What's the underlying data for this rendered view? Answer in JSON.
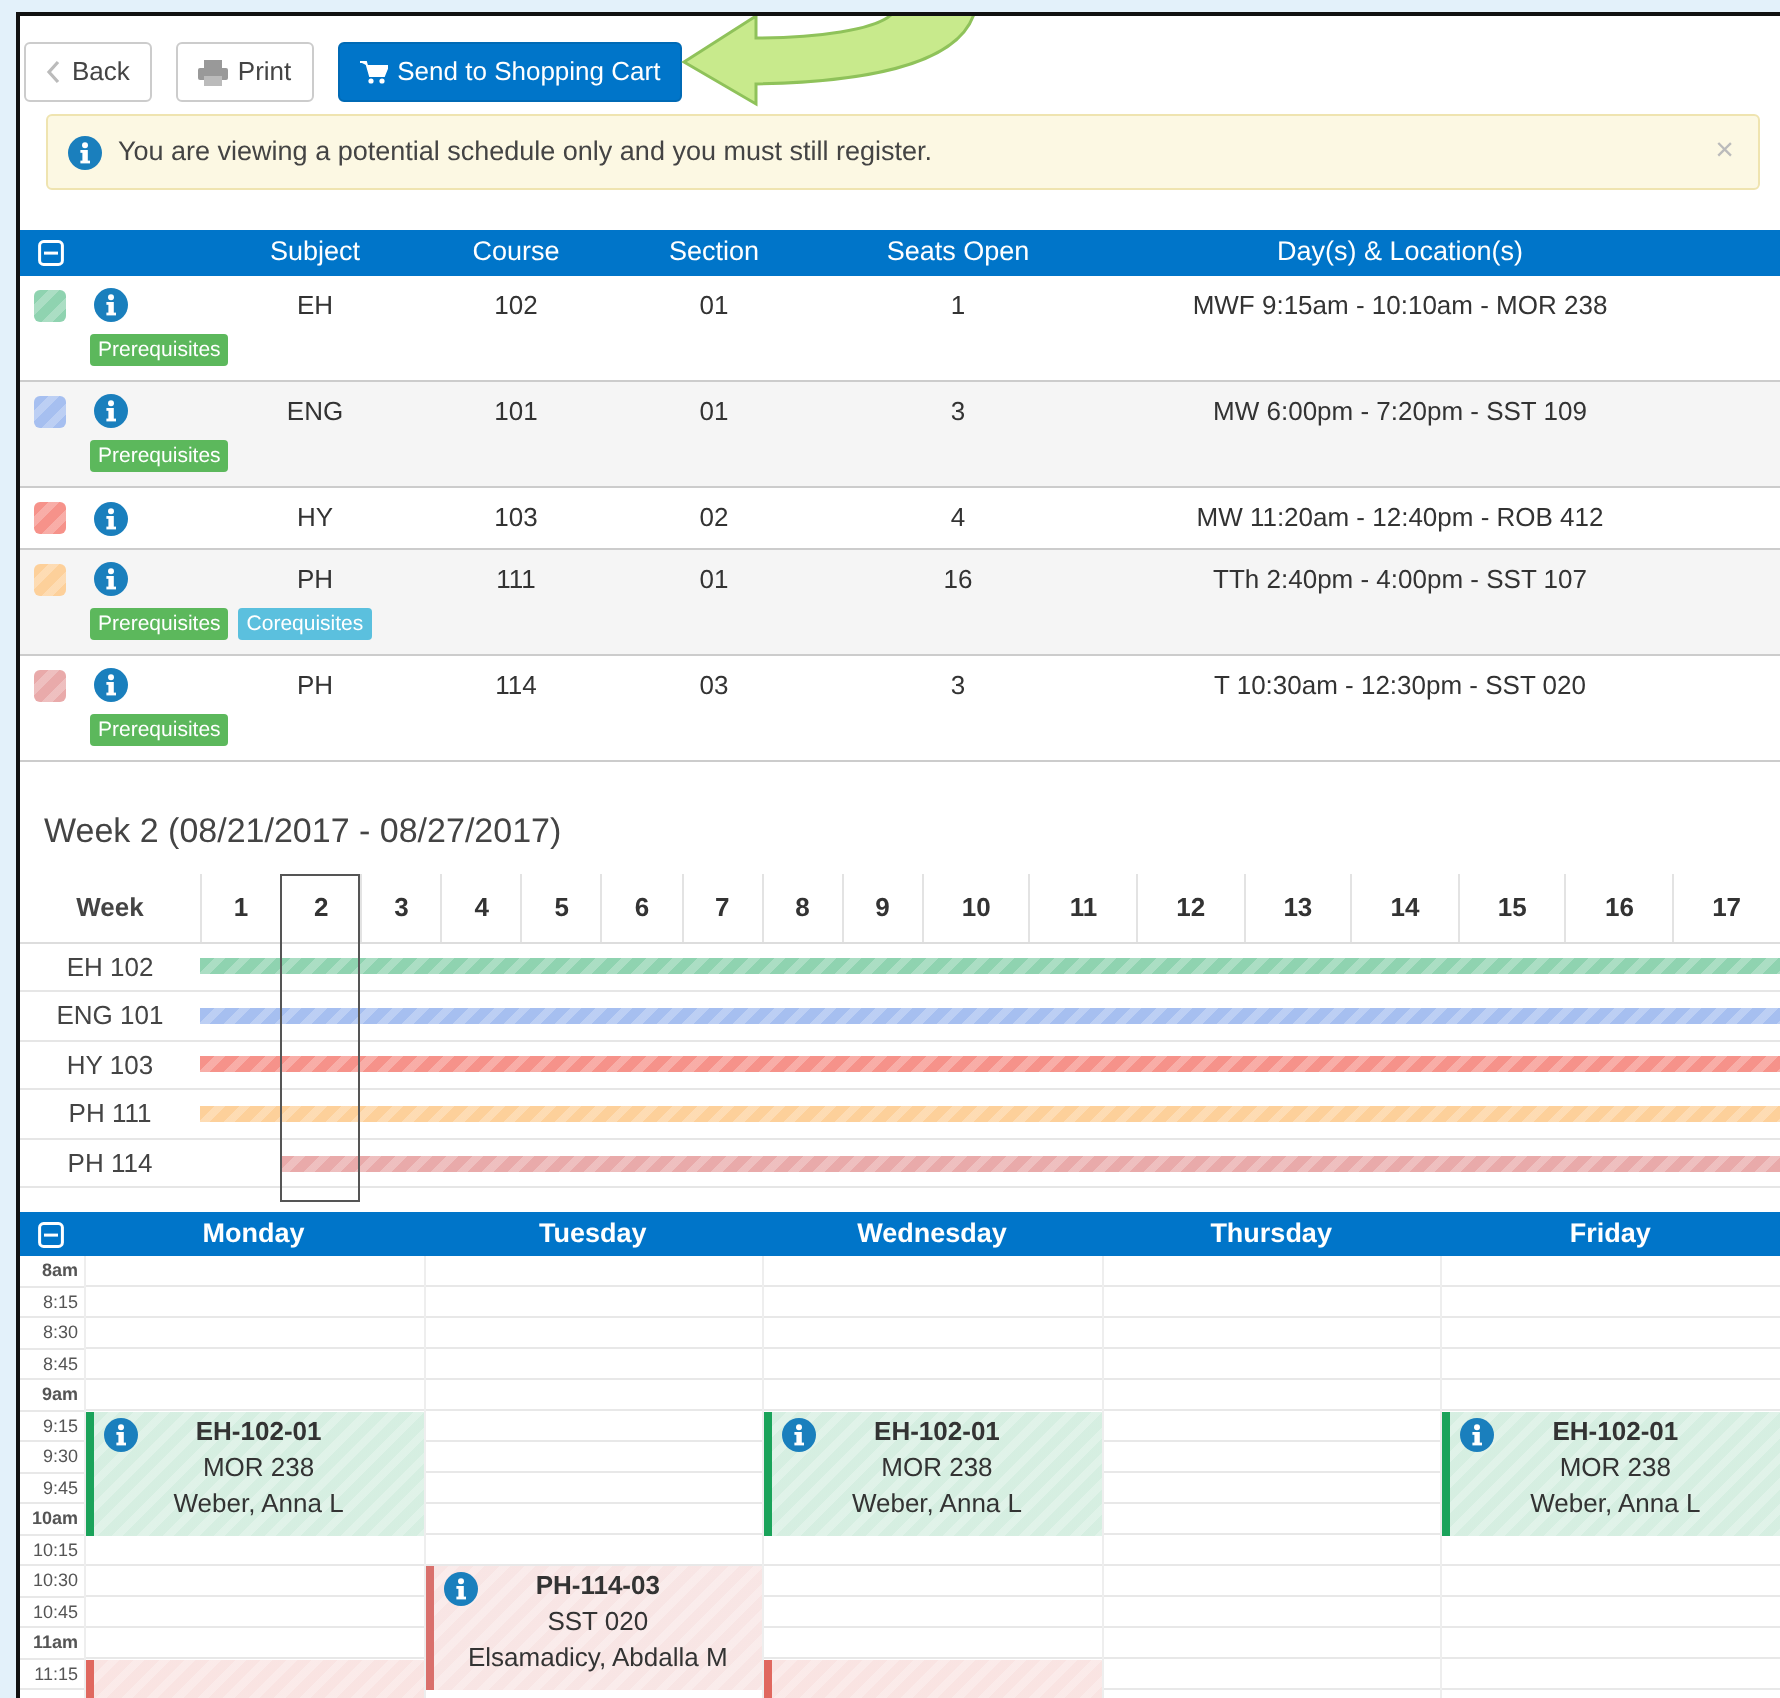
{
  "toolbar": {
    "buttons": [
      {
        "label": "Back",
        "kind": "back"
      },
      {
        "label": "Print",
        "kind": "print"
      },
      {
        "label": "Send to Shopping Cart",
        "kind": "cart"
      }
    ]
  },
  "alert": {
    "message": "You are viewing a potential schedule only and you must still register.",
    "close": "×"
  },
  "courses": {
    "columns": [
      "Subject",
      "Course",
      "Section",
      "Seats Open",
      "Day(s) & Location(s)"
    ],
    "rows": [
      {
        "color": "#8fd3b0",
        "subject": "EH",
        "course": "102",
        "section": "01",
        "seats": "1",
        "days": "MWF 9:15am - 10:10am - MOR 238",
        "badges": [
          {
            "label": "Prerequisites",
            "kind": "prerequisite"
          }
        ]
      },
      {
        "color": "#a6bff0",
        "subject": "ENG",
        "course": "101",
        "section": "01",
        "seats": "3",
        "days": "MW 6:00pm - 7:20pm - SST 109",
        "badges": [
          {
            "label": "Prerequisites",
            "kind": "prerequisite"
          }
        ]
      },
      {
        "color": "#f6928a",
        "subject": "HY",
        "course": "103",
        "section": "02",
        "seats": "4",
        "days": "MW 11:20am - 12:40pm - ROB 412"
      },
      {
        "color": "#fdd09a",
        "subject": "PH",
        "course": "111",
        "section": "01",
        "seats": "16",
        "days": "TTh 2:40pm - 4:00pm - SST 107",
        "badges": [
          {
            "label": "Prerequisites",
            "kind": "prerequisite"
          },
          {
            "label": "Corequisites",
            "kind": "corequisite"
          }
        ]
      },
      {
        "color": "#e9aaaa",
        "subject": "PH",
        "course": "114",
        "section": "03",
        "seats": "3",
        "days": "T 10:30am - 12:30pm - SST 020",
        "badges": [
          {
            "label": "Prerequisites",
            "kind": "prerequisite"
          }
        ]
      }
    ]
  },
  "week_title": "Week 2 (08/21/2017 - 08/27/2017)",
  "weeks": {
    "heading": "Week",
    "columns": [
      {
        "label": "1",
        "selected": false
      },
      {
        "label": "2",
        "selected": true
      },
      {
        "label": "3",
        "selected": false
      },
      {
        "label": "4",
        "selected": false
      },
      {
        "label": "5",
        "selected": false
      },
      {
        "label": "6",
        "selected": false
      },
      {
        "label": "7",
        "selected": false
      },
      {
        "label": "8",
        "selected": false
      },
      {
        "label": "9",
        "selected": false
      },
      {
        "label": "10",
        "selected": false
      },
      {
        "label": "11",
        "selected": false
      },
      {
        "label": "12",
        "selected": false
      },
      {
        "label": "13",
        "selected": false
      },
      {
        "label": "14",
        "selected": false
      },
      {
        "label": "15",
        "selected": false
      },
      {
        "label": "16",
        "selected": false
      },
      {
        "label": "17",
        "selected": false
      }
    ],
    "rows": [
      {
        "label": "EH 102",
        "color": "#8fd3b0",
        "in_week_1": true
      },
      {
        "label": "ENG 101",
        "color": "#a6bff0",
        "in_week_1": true
      },
      {
        "label": "HY 103",
        "color": "#f6928a",
        "in_week_1": true
      },
      {
        "label": "PH 111",
        "color": "#fdd09a",
        "in_week_1": true
      },
      {
        "label": "PH 114",
        "color": "#e9aaaa",
        "in_week_1": false
      }
    ]
  },
  "calendar": {
    "days": [
      {
        "label": "Monday",
        "blocks": [
          {
            "kind": "free"
          },
          {
            "kind": "free"
          },
          {
            "kind": "free"
          },
          {
            "kind": "free"
          },
          {
            "kind": "free"
          },
          {
            "kind": "class",
            "color": "#1aa35a",
            "code": "EH-102-01",
            "room": "MOR 238",
            "teacher": "Weber, Anna L"
          },
          {
            "kind": "free"
          },
          {
            "kind": "free"
          },
          {
            "kind": "free"
          },
          {
            "kind": "free"
          },
          {
            "kind": "class",
            "color": "#e0685f"
          }
        ]
      },
      {
        "label": "Tuesday",
        "blocks": [
          {
            "kind": "free"
          },
          {
            "kind": "free"
          },
          {
            "kind": "free"
          },
          {
            "kind": "free"
          },
          {
            "kind": "free"
          },
          {
            "kind": "free"
          },
          {
            "kind": "free"
          },
          {
            "kind": "free"
          },
          {
            "kind": "free"
          },
          {
            "kind": "free"
          },
          {
            "kind": "class",
            "color": "#d9706c",
            "code": "PH-114-03",
            "room": "SST 020",
            "teacher": "Elsamadicy, Abdalla M"
          }
        ]
      },
      {
        "label": "Wednesday",
        "blocks": [
          {
            "kind": "free"
          },
          {
            "kind": "free"
          },
          {
            "kind": "free"
          },
          {
            "kind": "free"
          },
          {
            "kind": "free"
          },
          {
            "kind": "class",
            "color": "#1aa35a",
            "code": "EH-102-01",
            "room": "MOR 238",
            "teacher": "Weber, Anna L"
          },
          {
            "kind": "free"
          },
          {
            "kind": "free"
          },
          {
            "kind": "free"
          },
          {
            "kind": "free"
          },
          {
            "kind": "class",
            "color": "#e0685f"
          }
        ]
      },
      {
        "label": "Thursday"
      },
      {
        "label": "Friday",
        "blocks": [
          {
            "kind": "free"
          },
          {
            "kind": "free"
          },
          {
            "kind": "free"
          },
          {
            "kind": "free"
          },
          {
            "kind": "free"
          },
          {
            "kind": "class",
            "color": "#1aa35a",
            "code": "EH-102-01",
            "room": "MOR 238",
            "teacher": "Weber, Anna L"
          }
        ]
      }
    ],
    "times": [
      {
        "label": "8am",
        "kind": "hour"
      },
      {
        "label": "8:15",
        "kind": "quarter"
      },
      {
        "label": "8:30",
        "kind": "quarter"
      },
      {
        "label": "8:45",
        "kind": "quarter"
      },
      {
        "label": "9am",
        "kind": "hour"
      },
      {
        "label": "9:15",
        "kind": "quarter"
      },
      {
        "label": "9:30",
        "kind": "quarter"
      },
      {
        "label": "9:45",
        "kind": "quarter"
      },
      {
        "label": "10am",
        "kind": "hour"
      },
      {
        "label": "10:15",
        "kind": "quarter"
      },
      {
        "label": "10:30",
        "kind": "quarter"
      },
      {
        "label": "10:45",
        "kind": "quarter"
      },
      {
        "label": "11am",
        "kind": "hour"
      },
      {
        "label": "11:15",
        "kind": "quarter"
      }
    ]
  }
}
